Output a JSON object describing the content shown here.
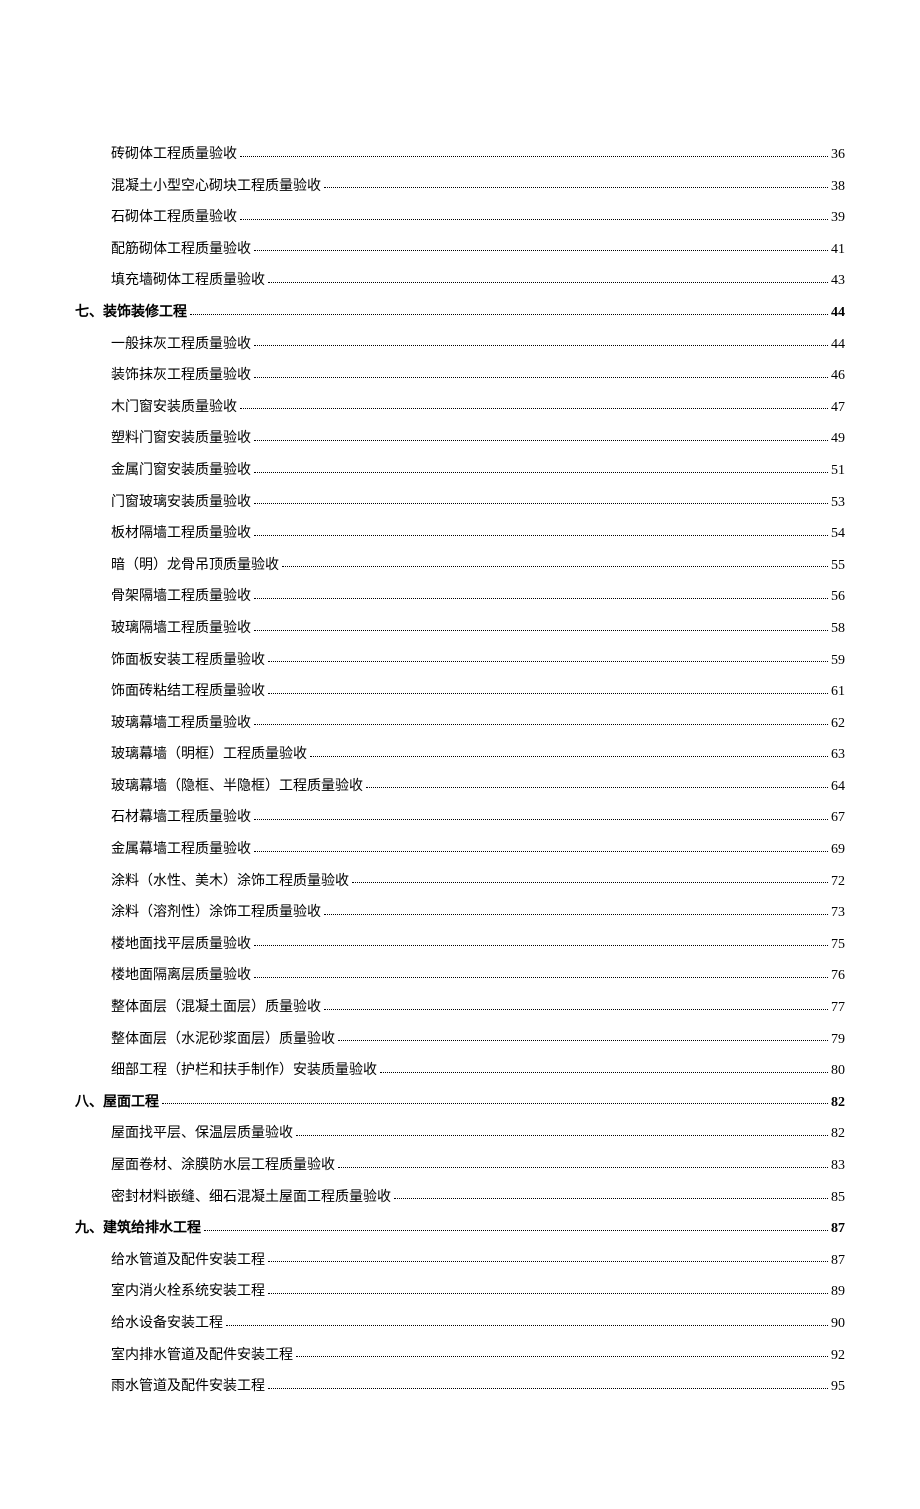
{
  "toc": [
    {
      "type": "sub",
      "label": "砖砌体工程质量验收",
      "page": "36"
    },
    {
      "type": "sub",
      "label": "混凝土小型空心砌块工程质量验收",
      "page": "38"
    },
    {
      "type": "sub",
      "label": "石砌体工程质量验收",
      "page": "39"
    },
    {
      "type": "sub",
      "label": "配筋砌体工程质量验收",
      "page": "41"
    },
    {
      "type": "sub",
      "label": "填充墙砌体工程质量验收",
      "page": "43"
    },
    {
      "type": "section",
      "label": "七、装饰装修工程",
      "page": "44"
    },
    {
      "type": "sub",
      "label": "一般抹灰工程质量验收",
      "page": "44"
    },
    {
      "type": "sub",
      "label": "装饰抹灰工程质量验收",
      "page": "46"
    },
    {
      "type": "sub",
      "label": "木门窗安装质量验收",
      "page": "47"
    },
    {
      "type": "sub",
      "label": "塑料门窗安装质量验收",
      "page": "49"
    },
    {
      "type": "sub",
      "label": "金属门窗安装质量验收",
      "page": "51"
    },
    {
      "type": "sub",
      "label": "门窗玻璃安装质量验收",
      "page": "53"
    },
    {
      "type": "sub",
      "label": "板材隔墙工程质量验收",
      "page": "54"
    },
    {
      "type": "sub",
      "label": "暗（明）龙骨吊顶质量验收",
      "page": "55"
    },
    {
      "type": "sub",
      "label": "骨架隔墙工程质量验收",
      "page": "56"
    },
    {
      "type": "sub",
      "label": "玻璃隔墙工程质量验收",
      "page": "58"
    },
    {
      "type": "sub",
      "label": "饰面板安装工程质量验收",
      "page": "59"
    },
    {
      "type": "sub",
      "label": "饰面砖粘结工程质量验收",
      "page": "61"
    },
    {
      "type": "sub",
      "label": "玻璃幕墙工程质量验收",
      "page": "62"
    },
    {
      "type": "sub",
      "label": "玻璃幕墙（明框）工程质量验收",
      "page": "63"
    },
    {
      "type": "sub",
      "label": "玻璃幕墙（隐框、半隐框）工程质量验收",
      "page": "64"
    },
    {
      "type": "sub",
      "label": "石材幕墙工程质量验收",
      "page": "67"
    },
    {
      "type": "sub",
      "label": "金属幕墙工程质量验收",
      "page": "69"
    },
    {
      "type": "sub",
      "label": "涂料（水性、美木）涂饰工程质量验收",
      "page": "72"
    },
    {
      "type": "sub",
      "label": "涂料（溶剂性）涂饰工程质量验收",
      "page": "73"
    },
    {
      "type": "sub",
      "label": "楼地面找平层质量验收",
      "page": "75"
    },
    {
      "type": "sub",
      "label": "楼地面隔离层质量验收",
      "page": "76"
    },
    {
      "type": "sub",
      "label": "整体面层（混凝土面层）质量验收",
      "page": "77"
    },
    {
      "type": "sub",
      "label": "整体面层（水泥砂浆面层）质量验收",
      "page": "79"
    },
    {
      "type": "sub",
      "label": "细部工程（护栏和扶手制作）安装质量验收",
      "page": "80"
    },
    {
      "type": "section",
      "label": "八、屋面工程",
      "page": "82"
    },
    {
      "type": "sub",
      "label": "屋面找平层、保温层质量验收",
      "page": "82"
    },
    {
      "type": "sub",
      "label": "屋面卷材、涂膜防水层工程质量验收",
      "page": "83"
    },
    {
      "type": "sub",
      "label": "密封材料嵌缝、细石混凝土屋面工程质量验收",
      "page": "85"
    },
    {
      "type": "section",
      "label": "九、建筑给排水工程",
      "page": "87"
    },
    {
      "type": "sub",
      "label": "给水管道及配件安装工程",
      "page": "87"
    },
    {
      "type": "sub",
      "label": "室内消火栓系统安装工程",
      "page": "89"
    },
    {
      "type": "sub",
      "label": "给水设备安装工程",
      "page": "90"
    },
    {
      "type": "sub",
      "label": "室内排水管道及配件安装工程",
      "page": "92"
    },
    {
      "type": "sub",
      "label": "雨水管道及配件安装工程",
      "page": "95"
    }
  ]
}
